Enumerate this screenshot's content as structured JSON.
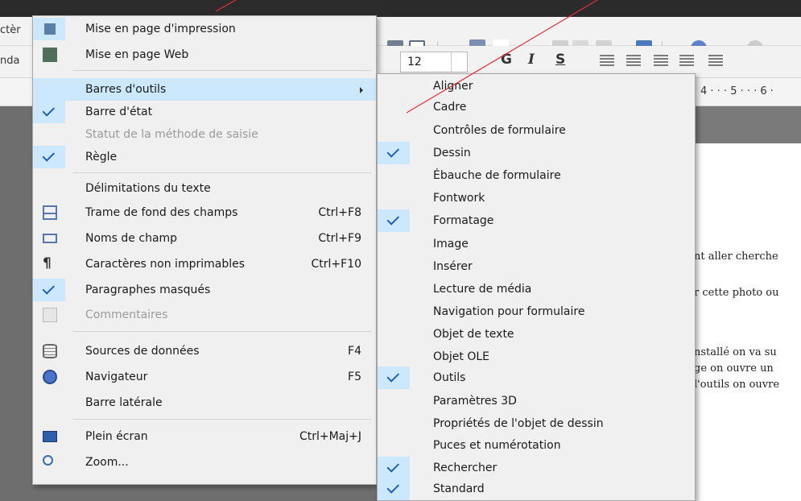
{
  "background": {
    "left_stubs": [
      "ctèr",
      "nda"
    ],
    "font_size": "12",
    "ruler_text": "4 · · · 5 · · · 6 ·",
    "format_buttons": [
      "G",
      "I",
      "S"
    ],
    "document_lines": [
      "nt aller cherche",
      "r cette photo ou",
      "nstallé on va su",
      "ge on ouvre un",
      "l'outils on ouvre"
    ]
  },
  "main_menu": {
    "items": [
      {
        "label": "Mise en page d'impression"
      },
      {
        "label": "Mise en page Web"
      },
      {
        "label": "Barres d'outils"
      },
      {
        "label": "Barre d'état"
      },
      {
        "label": "Statut de la méthode de saisie"
      },
      {
        "label": "Règle"
      },
      {
        "label": "Délimitations du texte"
      },
      {
        "label": "Trame de fond des champs",
        "shortcut": "Ctrl+F8"
      },
      {
        "label": "Noms de champ",
        "shortcut": "Ctrl+F9"
      },
      {
        "label": "Caractères non imprimables",
        "shortcut": "Ctrl+F10"
      },
      {
        "label": "Paragraphes masqués"
      },
      {
        "label": "Commentaires"
      },
      {
        "label": "Sources de données",
        "shortcut": "F4"
      },
      {
        "label": "Navigateur",
        "shortcut": "F5"
      },
      {
        "label": "Barre latérale"
      },
      {
        "label": "Plein écran",
        "shortcut": "Ctrl+Maj+J"
      },
      {
        "label": "Zoom..."
      }
    ]
  },
  "sub_menu": {
    "items": [
      {
        "label": "Aligner"
      },
      {
        "label": "Cadre"
      },
      {
        "label": "Contrôles de formulaire"
      },
      {
        "label": "Dessin"
      },
      {
        "label": "Ébauche de formulaire"
      },
      {
        "label": "Fontwork"
      },
      {
        "label": "Formatage"
      },
      {
        "label": "Image"
      },
      {
        "label": "Insérer"
      },
      {
        "label": "Lecture de média"
      },
      {
        "label": "Navigation pour formulaire"
      },
      {
        "label": "Objet de texte"
      },
      {
        "label": "Objet OLE"
      },
      {
        "label": "Outils"
      },
      {
        "label": "Paramètres 3D"
      },
      {
        "label": "Propriétés de l'objet de dessin"
      },
      {
        "label": "Puces et numérotation"
      },
      {
        "label": "Rechercher"
      },
      {
        "label": "Standard"
      }
    ]
  },
  "colors": {
    "highlight": "#cce8ff",
    "check": "#1e5fb8",
    "annotation_line": "#e0303a"
  }
}
